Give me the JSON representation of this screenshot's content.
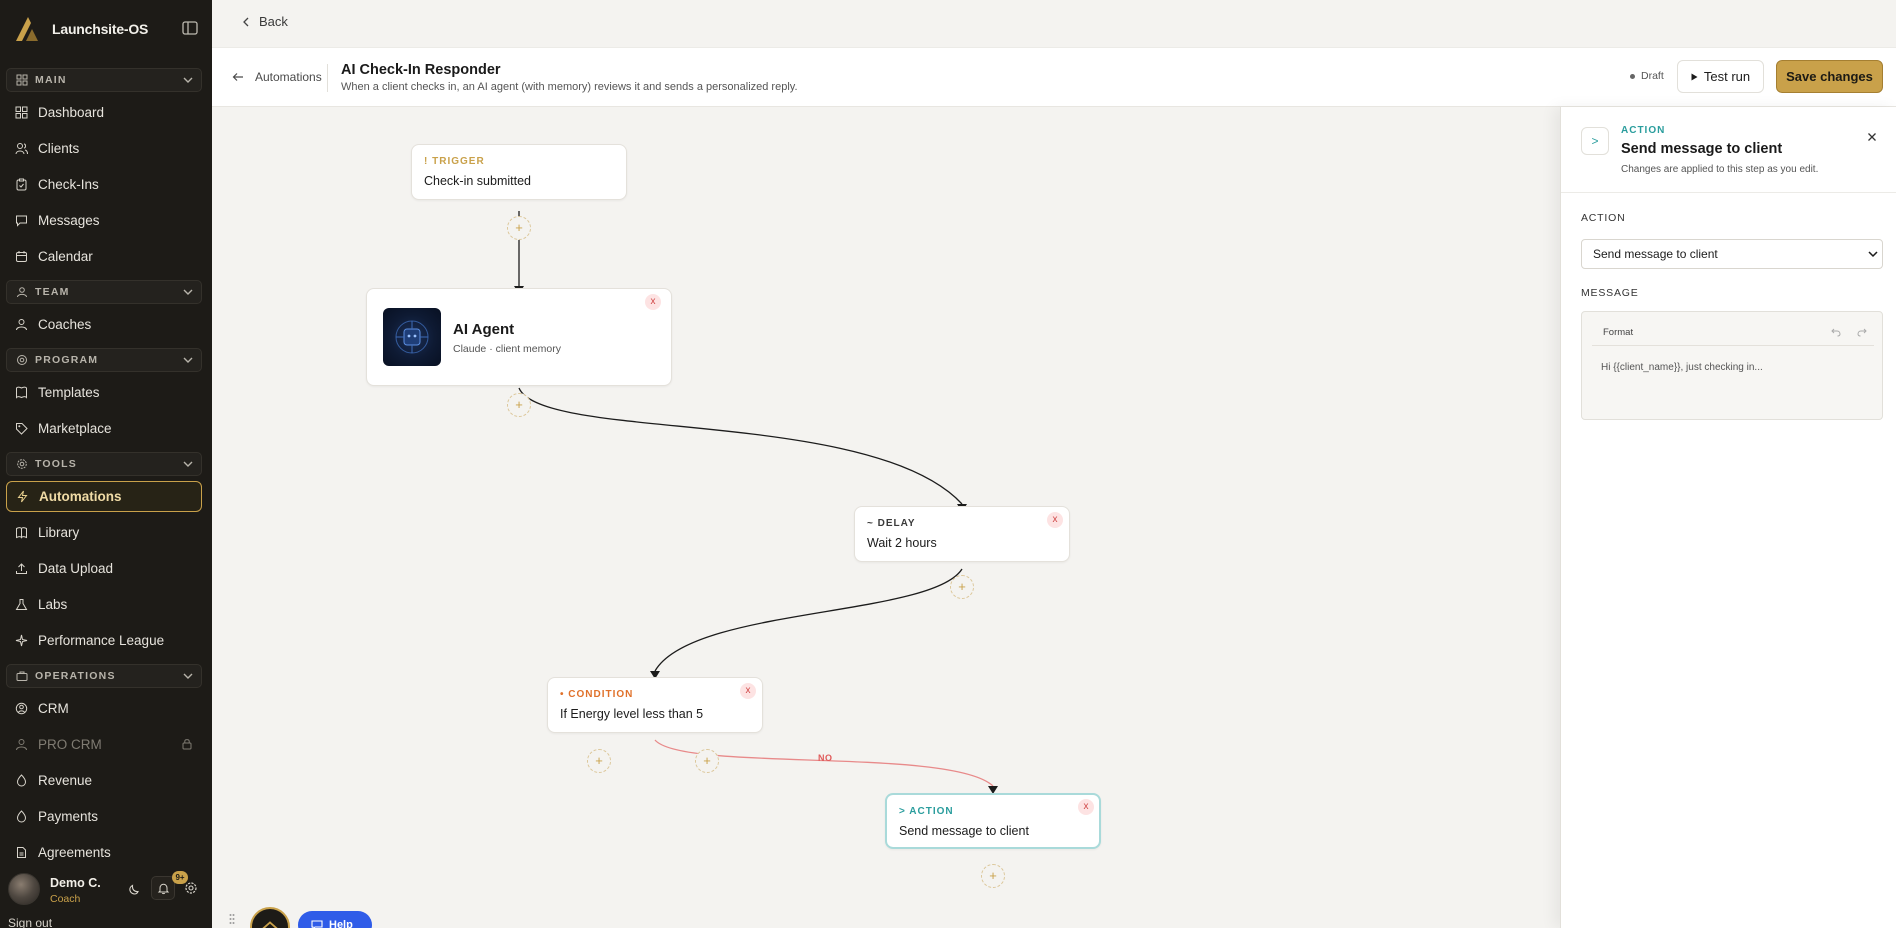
{
  "app": {
    "brand_name": "Launchsite-OS"
  },
  "sidebar": {
    "sections": {
      "main": "MAIN",
      "team": "TEAM",
      "program": "PROGRAM",
      "tools": "TOOLS",
      "operations": "OPERATIONS"
    },
    "items": {
      "dashboard": "Dashboard",
      "clients": "Clients",
      "checkins": "Check-Ins",
      "messages": "Messages",
      "calendar": "Calendar",
      "coaches": "Coaches",
      "templates": "Templates",
      "marketplace": "Marketplace",
      "automations": "Automations",
      "library": "Library",
      "data_upload": "Data Upload",
      "labs": "Labs",
      "performance_league": "Performance League",
      "crm": "CRM",
      "pro_crm": "PRO CRM",
      "revenue": "Revenue",
      "payments": "Payments",
      "agreements": "Agreements"
    },
    "active_item": "Automations",
    "user": {
      "name": "Demo C.",
      "role": "Coach",
      "notifications": "9+"
    },
    "sign_out": "Sign out"
  },
  "topbar": {
    "back_label": "Back"
  },
  "header": {
    "breadcrumb": "Automations",
    "title": "AI Check-In Responder",
    "subtitle": "When a client checks in, an AI agent (with memory) reviews it and sends a personalized reply.",
    "status": "Draft",
    "test_run_label": "Test run",
    "save_label": "Save changes"
  },
  "canvas": {
    "nodes": {
      "trigger": {
        "kind": "TRIGGER",
        "kind_icon": "!",
        "label": "Check-in submitted"
      },
      "ai_agent": {
        "title": "AI Agent",
        "subtitle": "Claude · client memory"
      },
      "delay": {
        "kind": "DELAY",
        "kind_icon": "~",
        "label": "Wait 2 hours"
      },
      "condition": {
        "kind": "CONDITION",
        "kind_icon": "•",
        "label": "If Energy level less than 5"
      },
      "action": {
        "kind": "ACTION",
        "kind_icon": ">",
        "label": "Send message to client"
      }
    },
    "branch_label_no": "NO",
    "delete_glyph": "x",
    "add_glyph": "+",
    "help_label": "Help",
    "colors": {
      "trigger": "#c9a14a",
      "delay": "#3a3a3a",
      "condition": "#e0712a",
      "action": "#2a9d9d",
      "no_branch": "#e05a5a"
    }
  },
  "panel": {
    "icon": ">",
    "kind": "ACTION",
    "title": "Send message to client",
    "note": "Changes are applied to this step as you edit.",
    "action_label": "ACTION",
    "action_value": "Send message to client",
    "message_label": "MESSAGE",
    "format_label": "Format",
    "message_text": "Hi {{client_name}}, just checking in..."
  },
  "icons": [
    "logo-icon",
    "collapse-sidebar-icon",
    "grid-icon",
    "users-icon",
    "clipboard-icon",
    "message-icon",
    "calendar-icon",
    "team-icon",
    "book-icon",
    "tag-icon",
    "gear-icon",
    "bolt-icon",
    "library-icon",
    "upload-icon",
    "flask-icon",
    "sparkle-icon",
    "briefcase-icon",
    "user-circle-icon",
    "lock-icon",
    "dollar-icon",
    "file-icon",
    "moon-icon",
    "bell-icon",
    "arrow-left-icon",
    "chevron-left-icon",
    "play-icon",
    "close-icon",
    "undo-icon",
    "redo-icon",
    "chevron-down-icon"
  ],
  "accent_color": "#c9a14a"
}
